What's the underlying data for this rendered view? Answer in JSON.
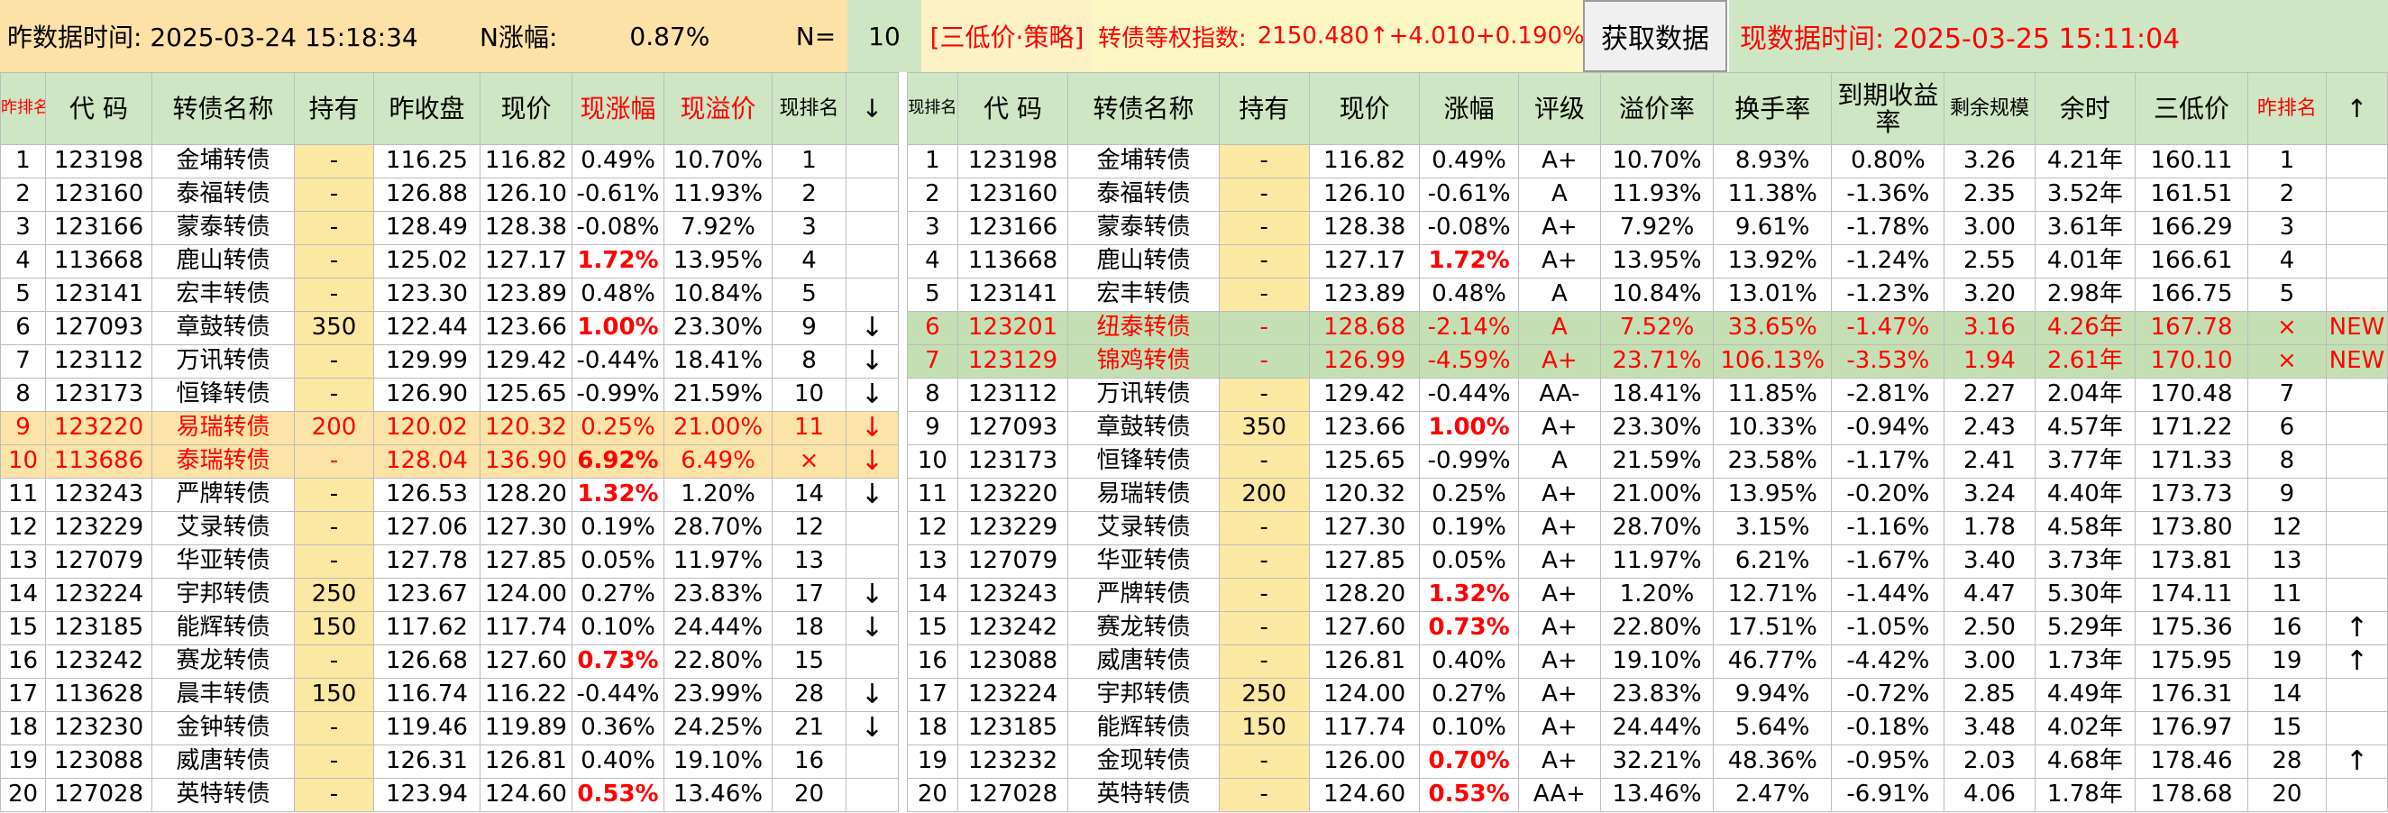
{
  "header": {
    "prev_time_label": "昨数据时间: 2025-03-24 15:18:34",
    "n_change_label": "N涨幅:",
    "n_change_value": "0.87%",
    "n_label": "N=",
    "n_value": "10",
    "strategy": "[三低价·策略]",
    "index_label": "转债等权指数:",
    "index_value": "2150.480↑+4.010+0.190%",
    "fetch_button": "获取数据",
    "curr_time_label": "现数据时间: 2025-03-25 15:11:04"
  },
  "left_columns": [
    "昨排名",
    "代 码",
    "转债名称",
    "持有",
    "昨收盘",
    "现价",
    "现涨幅",
    "现溢价",
    "现排名",
    "↓"
  ],
  "right_columns": [
    "现排名",
    "代 码",
    "转债名称",
    "持有",
    "现价",
    "涨幅",
    "评级",
    "溢价率",
    "换手率",
    "到期收益率",
    "剩余规模",
    "余时",
    "三低价",
    "昨排名",
    "↑"
  ],
  "left_rows": [
    {
      "rank": "1",
      "code": "123198",
      "name": "金埔转债",
      "hold": "-",
      "prev_close": "116.25",
      "price": "116.82",
      "chg": "0.49%",
      "chg_bold": false,
      "premium": "10.70%",
      "curr_rank": "1",
      "arrow": ""
    },
    {
      "rank": "2",
      "code": "123160",
      "name": "泰福转债",
      "hold": "-",
      "prev_close": "126.88",
      "price": "126.10",
      "chg": "-0.61%",
      "chg_bold": false,
      "premium": "11.93%",
      "curr_rank": "2",
      "arrow": ""
    },
    {
      "rank": "3",
      "code": "123166",
      "name": "蒙泰转债",
      "hold": "-",
      "prev_close": "128.49",
      "price": "128.38",
      "chg": "-0.08%",
      "chg_bold": false,
      "premium": "7.92%",
      "curr_rank": "3",
      "arrow": ""
    },
    {
      "rank": "4",
      "code": "113668",
      "name": "鹿山转债",
      "hold": "-",
      "prev_close": "125.02",
      "price": "127.17",
      "chg": "1.72%",
      "chg_bold": true,
      "premium": "13.95%",
      "curr_rank": "4",
      "arrow": ""
    },
    {
      "rank": "5",
      "code": "123141",
      "name": "宏丰转债",
      "hold": "-",
      "prev_close": "123.30",
      "price": "123.89",
      "chg": "0.48%",
      "chg_bold": false,
      "premium": "10.84%",
      "curr_rank": "5",
      "arrow": ""
    },
    {
      "rank": "6",
      "code": "127093",
      "name": "章鼓转债",
      "hold": "350",
      "prev_close": "122.44",
      "price": "123.66",
      "chg": "1.00%",
      "chg_bold": true,
      "premium": "23.30%",
      "curr_rank": "9",
      "arrow": "↓"
    },
    {
      "rank": "7",
      "code": "123112",
      "name": "万讯转债",
      "hold": "-",
      "prev_close": "129.99",
      "price": "129.42",
      "chg": "-0.44%",
      "chg_bold": false,
      "premium": "18.41%",
      "curr_rank": "8",
      "arrow": "↓"
    },
    {
      "rank": "8",
      "code": "123173",
      "name": "恒锋转债",
      "hold": "-",
      "prev_close": "126.90",
      "price": "125.65",
      "chg": "-0.99%",
      "chg_bold": false,
      "premium": "21.59%",
      "curr_rank": "10",
      "arrow": "↓"
    },
    {
      "rank": "9",
      "code": "123220",
      "name": "易瑞转债",
      "hold": "200",
      "prev_close": "120.02",
      "price": "120.32",
      "chg": "0.25%",
      "chg_bold": false,
      "premium": "21.00%",
      "curr_rank": "11",
      "arrow": "↓",
      "hl": true
    },
    {
      "rank": "10",
      "code": "113686",
      "name": "泰瑞转债",
      "hold": "-",
      "prev_close": "128.04",
      "price": "136.90",
      "chg": "6.92%",
      "chg_bold": true,
      "premium": "6.49%",
      "curr_rank": "×",
      "arrow": "↓",
      "hl": true
    },
    {
      "rank": "11",
      "code": "123243",
      "name": "严牌转债",
      "hold": "-",
      "prev_close": "126.53",
      "price": "128.20",
      "chg": "1.32%",
      "chg_bold": true,
      "premium": "1.20%",
      "curr_rank": "14",
      "arrow": "↓"
    },
    {
      "rank": "12",
      "code": "123229",
      "name": "艾录转债",
      "hold": "-",
      "prev_close": "127.06",
      "price": "127.30",
      "chg": "0.19%",
      "chg_bold": false,
      "premium": "28.70%",
      "curr_rank": "12",
      "arrow": ""
    },
    {
      "rank": "13",
      "code": "127079",
      "name": "华亚转债",
      "hold": "-",
      "prev_close": "127.78",
      "price": "127.85",
      "chg": "0.05%",
      "chg_bold": false,
      "premium": "11.97%",
      "curr_rank": "13",
      "arrow": ""
    },
    {
      "rank": "14",
      "code": "123224",
      "name": "宇邦转债",
      "hold": "250",
      "prev_close": "123.67",
      "price": "124.00",
      "chg": "0.27%",
      "chg_bold": false,
      "premium": "23.83%",
      "curr_rank": "17",
      "arrow": "↓"
    },
    {
      "rank": "15",
      "code": "123185",
      "name": "能辉转债",
      "hold": "150",
      "prev_close": "117.62",
      "price": "117.74",
      "chg": "0.10%",
      "chg_bold": false,
      "premium": "24.44%",
      "curr_rank": "18",
      "arrow": "↓"
    },
    {
      "rank": "16",
      "code": "123242",
      "name": "赛龙转债",
      "hold": "-",
      "prev_close": "126.68",
      "price": "127.60",
      "chg": "0.73%",
      "chg_bold": true,
      "premium": "22.80%",
      "curr_rank": "15",
      "arrow": ""
    },
    {
      "rank": "17",
      "code": "113628",
      "name": "晨丰转债",
      "hold": "150",
      "prev_close": "116.74",
      "price": "116.22",
      "chg": "-0.44%",
      "chg_bold": false,
      "premium": "23.99%",
      "curr_rank": "28",
      "arrow": "↓"
    },
    {
      "rank": "18",
      "code": "123230",
      "name": "金钟转债",
      "hold": "-",
      "prev_close": "119.46",
      "price": "119.89",
      "chg": "0.36%",
      "chg_bold": false,
      "premium": "24.25%",
      "curr_rank": "21",
      "arrow": "↓"
    },
    {
      "rank": "19",
      "code": "123088",
      "name": "威唐转债",
      "hold": "-",
      "prev_close": "126.31",
      "price": "126.81",
      "chg": "0.40%",
      "chg_bold": false,
      "premium": "19.10%",
      "curr_rank": "16",
      "arrow": ""
    },
    {
      "rank": "20",
      "code": "127028",
      "name": "英特转债",
      "hold": "-",
      "prev_close": "123.94",
      "price": "124.60",
      "chg": "0.53%",
      "chg_bold": true,
      "premium": "13.46%",
      "curr_rank": "20",
      "arrow": ""
    }
  ],
  "right_rows": [
    {
      "rank": "1",
      "code": "123198",
      "name": "金埔转债",
      "hold": "-",
      "price": "116.82",
      "chg": "0.49%",
      "chg_bold": false,
      "rating": "A+",
      "premium": "10.70%",
      "turnover": "8.93%",
      "ytm": "0.80%",
      "scale": "3.26",
      "remain": "4.21年",
      "tri": "160.11",
      "prev_rank": "1",
      "arrow": ""
    },
    {
      "rank": "2",
      "code": "123160",
      "name": "泰福转债",
      "hold": "-",
      "price": "126.10",
      "chg": "-0.61%",
      "chg_bold": false,
      "rating": "A",
      "premium": "11.93%",
      "turnover": "11.38%",
      "ytm": "-1.36%",
      "scale": "2.35",
      "remain": "3.52年",
      "tri": "161.51",
      "prev_rank": "2",
      "arrow": ""
    },
    {
      "rank": "3",
      "code": "123166",
      "name": "蒙泰转债",
      "hold": "-",
      "price": "128.38",
      "chg": "-0.08%",
      "chg_bold": false,
      "rating": "A+",
      "premium": "7.92%",
      "turnover": "9.61%",
      "ytm": "-1.78%",
      "scale": "3.00",
      "remain": "3.61年",
      "tri": "166.29",
      "prev_rank": "3",
      "arrow": ""
    },
    {
      "rank": "4",
      "code": "113668",
      "name": "鹿山转债",
      "hold": "-",
      "price": "127.17",
      "chg": "1.72%",
      "chg_bold": true,
      "rating": "A+",
      "premium": "13.95%",
      "turnover": "13.92%",
      "ytm": "-1.24%",
      "scale": "2.55",
      "remain": "4.01年",
      "tri": "166.61",
      "prev_rank": "4",
      "arrow": ""
    },
    {
      "rank": "5",
      "code": "123141",
      "name": "宏丰转债",
      "hold": "-",
      "price": "123.89",
      "chg": "0.48%",
      "chg_bold": false,
      "rating": "A",
      "premium": "10.84%",
      "turnover": "13.01%",
      "ytm": "-1.23%",
      "scale": "3.20",
      "remain": "2.98年",
      "tri": "166.75",
      "prev_rank": "5",
      "arrow": ""
    },
    {
      "rank": "6",
      "code": "123201",
      "name": "纽泰转债",
      "hold": "-",
      "price": "128.68",
      "chg": "-2.14%",
      "chg_bold": false,
      "rating": "A",
      "premium": "7.52%",
      "turnover": "33.65%",
      "ytm": "-1.47%",
      "scale": "3.16",
      "remain": "4.26年",
      "tri": "167.78",
      "prev_rank": "×",
      "arrow": "NEW",
      "new": true
    },
    {
      "rank": "7",
      "code": "123129",
      "name": "锦鸡转债",
      "hold": "-",
      "price": "126.99",
      "chg": "-4.59%",
      "chg_bold": false,
      "rating": "A+",
      "premium": "23.71%",
      "turnover": "106.13%",
      "ytm": "-3.53%",
      "scale": "1.94",
      "remain": "2.61年",
      "tri": "170.10",
      "prev_rank": "×",
      "arrow": "NEW",
      "new": true
    },
    {
      "rank": "8",
      "code": "123112",
      "name": "万讯转债",
      "hold": "-",
      "price": "129.42",
      "chg": "-0.44%",
      "chg_bold": false,
      "rating": "AA-",
      "premium": "18.41%",
      "turnover": "11.85%",
      "ytm": "-2.81%",
      "scale": "2.27",
      "remain": "2.04年",
      "tri": "170.48",
      "prev_rank": "7",
      "arrow": ""
    },
    {
      "rank": "9",
      "code": "127093",
      "name": "章鼓转债",
      "hold": "350",
      "price": "123.66",
      "chg": "1.00%",
      "chg_bold": true,
      "rating": "A+",
      "premium": "23.30%",
      "turnover": "10.33%",
      "ytm": "-0.94%",
      "scale": "2.43",
      "remain": "4.57年",
      "tri": "171.22",
      "prev_rank": "6",
      "arrow": ""
    },
    {
      "rank": "10",
      "code": "123173",
      "name": "恒锋转债",
      "hold": "-",
      "price": "125.65",
      "chg": "-0.99%",
      "chg_bold": false,
      "rating": "A",
      "premium": "21.59%",
      "turnover": "23.58%",
      "ytm": "-1.17%",
      "scale": "2.41",
      "remain": "3.77年",
      "tri": "171.33",
      "prev_rank": "8",
      "arrow": ""
    },
    {
      "rank": "11",
      "code": "123220",
      "name": "易瑞转债",
      "hold": "200",
      "price": "120.32",
      "chg": "0.25%",
      "chg_bold": false,
      "rating": "A+",
      "premium": "21.00%",
      "turnover": "13.95%",
      "ytm": "-0.20%",
      "scale": "3.24",
      "remain": "4.40年",
      "tri": "173.73",
      "prev_rank": "9",
      "arrow": ""
    },
    {
      "rank": "12",
      "code": "123229",
      "name": "艾录转债",
      "hold": "-",
      "price": "127.30",
      "chg": "0.19%",
      "chg_bold": false,
      "rating": "A+",
      "premium": "28.70%",
      "turnover": "3.15%",
      "ytm": "-1.16%",
      "scale": "1.78",
      "remain": "4.58年",
      "tri": "173.80",
      "prev_rank": "12",
      "arrow": ""
    },
    {
      "rank": "13",
      "code": "127079",
      "name": "华亚转债",
      "hold": "-",
      "price": "127.85",
      "chg": "0.05%",
      "chg_bold": false,
      "rating": "A+",
      "premium": "11.97%",
      "turnover": "6.21%",
      "ytm": "-1.67%",
      "scale": "3.40",
      "remain": "3.73年",
      "tri": "173.81",
      "prev_rank": "13",
      "arrow": ""
    },
    {
      "rank": "14",
      "code": "123243",
      "name": "严牌转债",
      "hold": "-",
      "price": "128.20",
      "chg": "1.32%",
      "chg_bold": true,
      "rating": "A+",
      "premium": "1.20%",
      "turnover": "12.71%",
      "ytm": "-1.44%",
      "scale": "4.47",
      "remain": "5.30年",
      "tri": "174.11",
      "prev_rank": "11",
      "arrow": ""
    },
    {
      "rank": "15",
      "code": "123242",
      "name": "赛龙转债",
      "hold": "-",
      "price": "127.60",
      "chg": "0.73%",
      "chg_bold": true,
      "rating": "A+",
      "premium": "22.80%",
      "turnover": "17.51%",
      "ytm": "-1.05%",
      "scale": "2.50",
      "remain": "5.29年",
      "tri": "175.36",
      "prev_rank": "16",
      "arrow": "↑"
    },
    {
      "rank": "16",
      "code": "123088",
      "name": "威唐转债",
      "hold": "-",
      "price": "126.81",
      "chg": "0.40%",
      "chg_bold": false,
      "rating": "A+",
      "premium": "19.10%",
      "turnover": "46.77%",
      "ytm": "-4.42%",
      "scale": "3.00",
      "remain": "1.73年",
      "tri": "175.95",
      "prev_rank": "19",
      "arrow": "↑"
    },
    {
      "rank": "17",
      "code": "123224",
      "name": "宇邦转债",
      "hold": "250",
      "price": "124.00",
      "chg": "0.27%",
      "chg_bold": false,
      "rating": "A+",
      "premium": "23.83%",
      "turnover": "9.94%",
      "ytm": "-0.72%",
      "scale": "2.85",
      "remain": "4.49年",
      "tri": "176.31",
      "prev_rank": "14",
      "arrow": ""
    },
    {
      "rank": "18",
      "code": "123185",
      "name": "能辉转债",
      "hold": "150",
      "price": "117.74",
      "chg": "0.10%",
      "chg_bold": false,
      "rating": "A+",
      "premium": "24.44%",
      "turnover": "5.64%",
      "ytm": "-0.18%",
      "scale": "3.48",
      "remain": "4.02年",
      "tri": "176.97",
      "prev_rank": "15",
      "arrow": ""
    },
    {
      "rank": "19",
      "code": "123232",
      "name": "金现转债",
      "hold": "-",
      "price": "126.00",
      "chg": "0.70%",
      "chg_bold": true,
      "rating": "A+",
      "premium": "32.21%",
      "turnover": "48.36%",
      "ytm": "-0.95%",
      "scale": "2.03",
      "remain": "4.68年",
      "tri": "178.46",
      "prev_rank": "28",
      "arrow": "↑"
    },
    {
      "rank": "20",
      "code": "127028",
      "name": "英特转债",
      "hold": "-",
      "price": "124.60",
      "chg": "0.53%",
      "chg_bold": true,
      "rating": "AA+",
      "premium": "13.46%",
      "turnover": "2.47%",
      "ytm": "-6.91%",
      "scale": "4.06",
      "remain": "1.78年",
      "tri": "178.68",
      "prev_rank": "20",
      "arrow": ""
    }
  ],
  "colors": {
    "header_green": "#cfe6c5",
    "hold_yellow": "#fbe9a3",
    "highlight_orange": "#fce4a8",
    "new_green": "#c5dfb4",
    "red": "#ff0000",
    "strategy_bg": "#fdf2c6",
    "time_green": "#cfe6c5"
  }
}
